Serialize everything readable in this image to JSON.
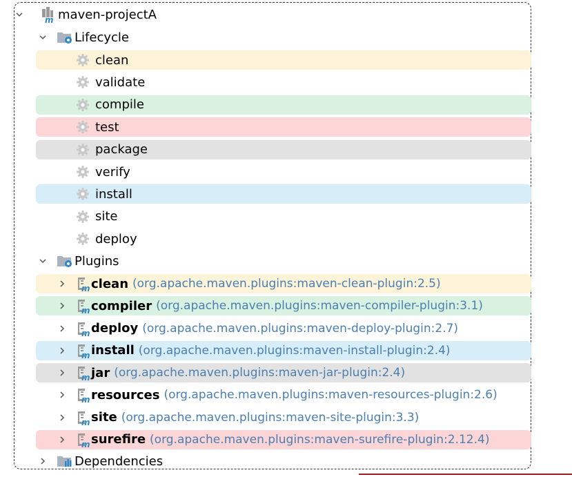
{
  "root": {
    "label": "maven-projectA",
    "icon": "maven-module-icon"
  },
  "lifecycle": {
    "label": "Lifecycle",
    "icon": "lifecycle-folder-icon",
    "items": [
      {
        "label": "clean",
        "highlight": "#fdf3d9"
      },
      {
        "label": "validate",
        "highlight": ""
      },
      {
        "label": "compile",
        "highlight": "#d9f1e1"
      },
      {
        "label": "test",
        "highlight": "#fcd6d6"
      },
      {
        "label": "package",
        "highlight": "#e2e2e2"
      },
      {
        "label": "verify",
        "highlight": ""
      },
      {
        "label": "install",
        "highlight": "#d7eef9"
      },
      {
        "label": "site",
        "highlight": ""
      },
      {
        "label": "deploy",
        "highlight": ""
      }
    ]
  },
  "plugins": {
    "label": "Plugins",
    "icon": "plugins-folder-icon",
    "items": [
      {
        "name": "clean",
        "coord": "(org.apache.maven.plugins:maven-clean-plugin:2.5)",
        "highlight": "#fdf3d9"
      },
      {
        "name": "compiler",
        "coord": "(org.apache.maven.plugins:maven-compiler-plugin:3.1)",
        "highlight": "#d9f1e1"
      },
      {
        "name": "deploy",
        "coord": "(org.apache.maven.plugins:maven-deploy-plugin:2.7)",
        "highlight": ""
      },
      {
        "name": "install",
        "coord": "(org.apache.maven.plugins:maven-install-plugin:2.4)",
        "highlight": "#d7eef9"
      },
      {
        "name": "jar",
        "coord": "(org.apache.maven.plugins:maven-jar-plugin:2.4)",
        "highlight": "#e2e2e2"
      },
      {
        "name": "resources",
        "coord": "(org.apache.maven.plugins:maven-resources-plugin:2.6)",
        "highlight": ""
      },
      {
        "name": "site",
        "coord": "(org.apache.maven.plugins:maven-site-plugin:3.3)",
        "highlight": ""
      },
      {
        "name": "surefire",
        "coord": "(org.apache.maven.plugins:maven-surefire-plugin:2.12.4)",
        "highlight": "#fcd6d6"
      }
    ]
  },
  "dependencies": {
    "label": "Dependencies",
    "icon": "dependencies-folder-icon"
  },
  "colors": {
    "yellow": "#fdf3d9",
    "green": "#d9f1e1",
    "red": "#fcd6d6",
    "gray": "#e2e2e2",
    "blue": "#d7eef9",
    "coord_text": "#4a7fb0"
  }
}
